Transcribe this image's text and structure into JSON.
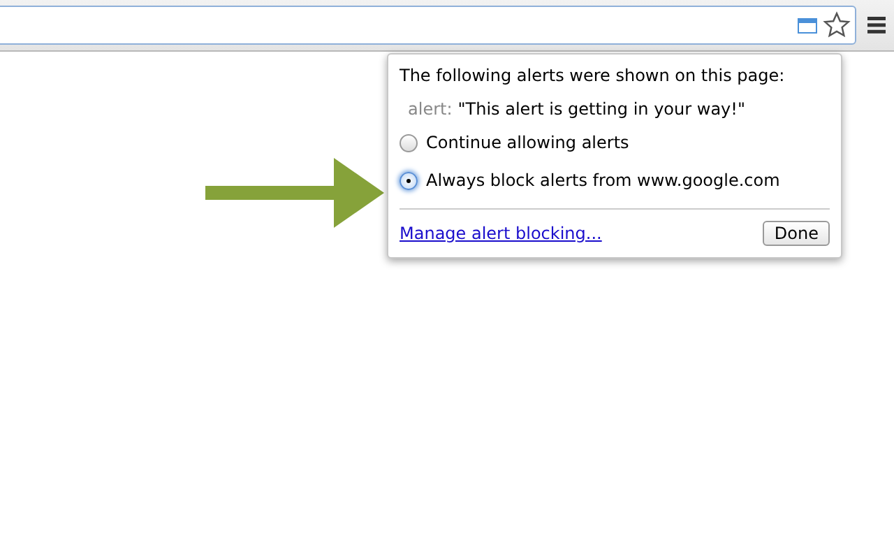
{
  "bubble": {
    "heading": "The following alerts were shown on this page:",
    "alert": {
      "label": "alert:",
      "message": "\"This alert is getting in your way!\""
    },
    "options": [
      {
        "label": "Continue allowing alerts",
        "selected": false
      },
      {
        "label": "Always block alerts from www.google.com",
        "selected": true
      }
    ],
    "link": "Manage alert blocking...",
    "button": "Done"
  }
}
